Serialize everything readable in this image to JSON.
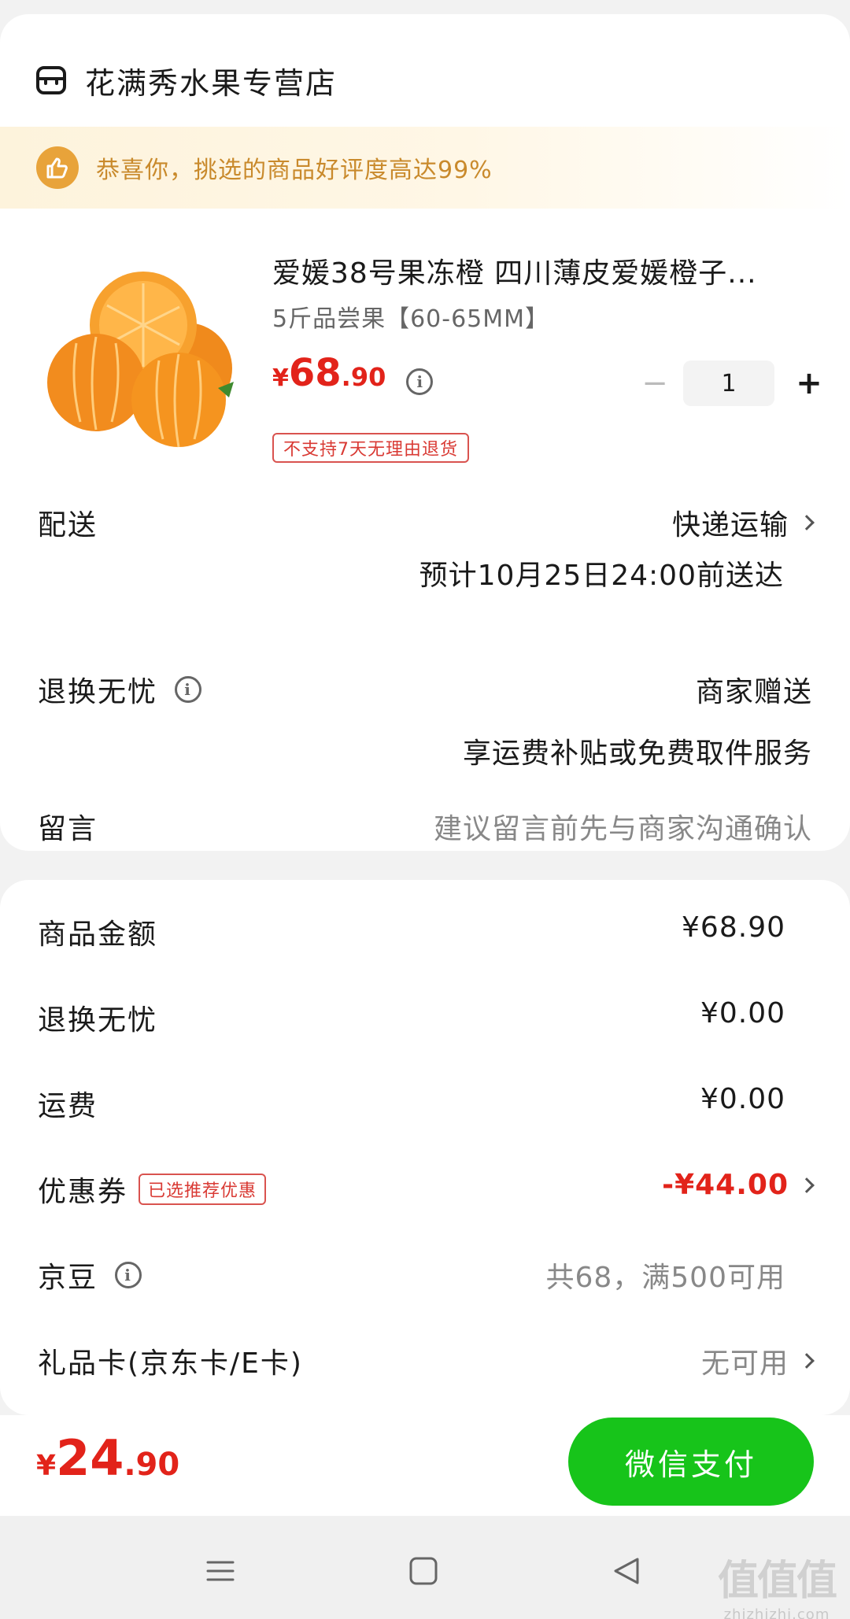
{
  "store": {
    "name": "花满秀水果专营店",
    "icon": "store-icon"
  },
  "banner": {
    "text": "恭喜你，挑选的商品好评度高达99%",
    "icon": "thumbs-up-icon",
    "accent": "#c98a2c"
  },
  "product": {
    "title": "爱媛38号果冻橙 四川薄皮爱媛橙子...",
    "spec": "5斤品尝果【60-65MM】",
    "price": {
      "currency": "¥",
      "integer": "68",
      "decimal": ".90"
    },
    "quantity": "1",
    "qty_minus": "−",
    "qty_plus": "+",
    "tag": "不支持7天无理由退货",
    "image_icon": "orange-fruit-image"
  },
  "delivery": {
    "label": "配送",
    "method": "快递运输",
    "estimate": "预计10月25日24:00前送达"
  },
  "return_worry_free": {
    "label": "退换无忧",
    "value": "商家赠送",
    "desc": "享运费补贴或免费取件服务"
  },
  "message": {
    "label": "留言",
    "placeholder": "建议留言前先与商家沟通确认"
  },
  "summary": {
    "goods_amount": {
      "label": "商品金额",
      "value": "¥68.90"
    },
    "return_fee": {
      "label": "退换无忧",
      "value": "¥0.00"
    },
    "shipping": {
      "label": "运费",
      "value": "¥0.00"
    },
    "coupon": {
      "label": "优惠券",
      "tag": "已选推荐优惠",
      "value": "-¥44.00"
    },
    "jingdou": {
      "label": "京豆",
      "value": "共68，满500可用"
    },
    "gift_card": {
      "label": "礼品卡(京东卡/E卡)",
      "value": "无可用"
    }
  },
  "pay": {
    "total": {
      "currency": "¥",
      "integer": "24",
      "decimal": ".90"
    },
    "button": "微信支付",
    "button_color": "#17c41a",
    "price_color": "#e2231a"
  },
  "watermark": {
    "big": "值值值",
    "small": "zhizhizhi.com"
  }
}
